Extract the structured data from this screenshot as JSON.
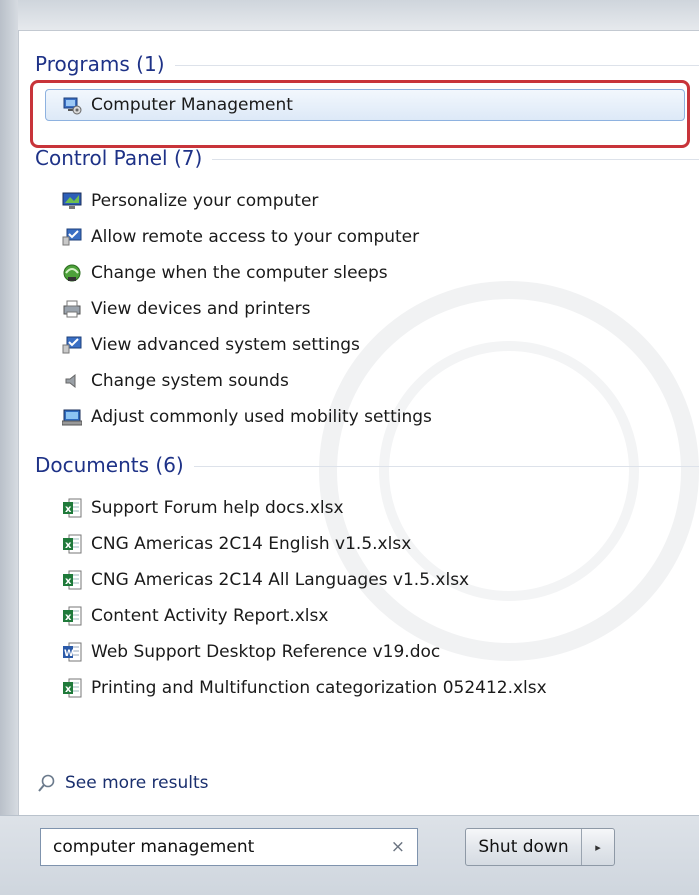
{
  "sections": {
    "programs": {
      "heading": "Programs (1)",
      "items": [
        {
          "label": "Computer Management",
          "icon": "computer-management-icon"
        }
      ]
    },
    "control_panel": {
      "heading": "Control Panel (7)",
      "items": [
        {
          "label": "Personalize your computer",
          "icon": "personalize-icon"
        },
        {
          "label": "Allow remote access to your computer",
          "icon": "remote-access-icon"
        },
        {
          "label": "Change when the computer sleeps",
          "icon": "power-options-icon"
        },
        {
          "label": "View devices and printers",
          "icon": "printer-icon"
        },
        {
          "label": "View advanced system settings",
          "icon": "system-icon"
        },
        {
          "label": "Change system sounds",
          "icon": "speaker-icon"
        },
        {
          "label": "Adjust commonly used mobility settings",
          "icon": "mobility-center-icon"
        }
      ]
    },
    "documents": {
      "heading": "Documents (6)",
      "items": [
        {
          "label": "Support Forum help docs.xlsx",
          "icon": "excel-file-icon"
        },
        {
          "label": "CNG Americas 2C14 English v1.5.xlsx",
          "icon": "excel-file-icon"
        },
        {
          "label": "CNG Americas 2C14 All Languages v1.5.xlsx",
          "icon": "excel-file-icon"
        },
        {
          "label": "Content Activity Report.xlsx",
          "icon": "excel-file-icon"
        },
        {
          "label": "Web Support Desktop Reference v19.doc",
          "icon": "word-file-icon"
        },
        {
          "label": "Printing and Multifunction categorization 052412.xlsx",
          "icon": "excel-file-icon"
        }
      ]
    }
  },
  "see_more": "See more results",
  "search": {
    "value": "computer management",
    "clear_glyph": "×"
  },
  "shutdown": {
    "label": "Shut down",
    "arrow_glyph": "▸"
  },
  "colors": {
    "heading": "#1e3287",
    "highlight_border": "#c8343a",
    "selection": "#dde9f7"
  }
}
